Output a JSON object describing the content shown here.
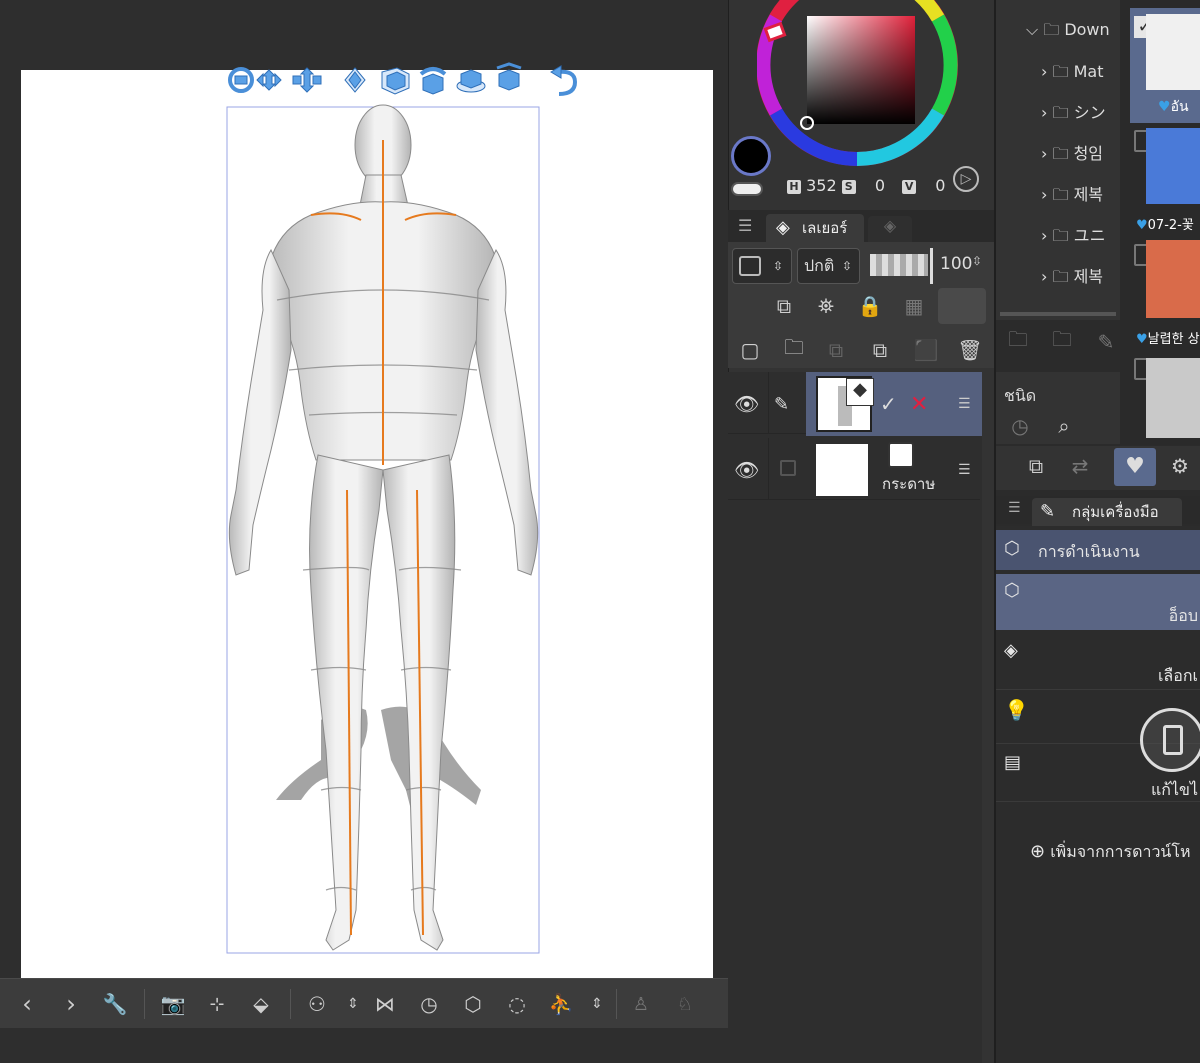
{
  "canvas": {
    "toolbar3d_icons": [
      "rotate-camera-icon",
      "pan-camera-icon",
      "dolly-camera-icon",
      "move-xy-icon",
      "rotate-object-icon",
      "rotate-horizontal-icon",
      "rotate-on-plane-icon",
      "move-on-plane-icon",
      "undo-pose-icon"
    ],
    "bottom_icons": [
      "prev-icon",
      "next-icon",
      "wrench-icon",
      "camera-icon",
      "fit-icon",
      "ground-icon",
      "add-model-icon",
      "stepper-icon",
      "flip-icon",
      "clock-icon",
      "cube-icon",
      "rotate-dotted-icon",
      "pose-icon",
      "stepper2-icon",
      "mannequin-icon",
      "mannequin2-icon"
    ]
  },
  "color_panel": {
    "h_label": "H",
    "h_value": "352",
    "s_label": "S",
    "s_value": "0",
    "v_label": "V",
    "v_value": "0",
    "main_color": "#000000",
    "accent_red": "#c8102e"
  },
  "layer_panel": {
    "tab_label": "เลเยอร์",
    "blend_mode": "ปกติ",
    "opacity": "100",
    "layers": [
      {
        "name": "",
        "selected": true
      },
      {
        "name": "กระดาษ",
        "selected": false
      }
    ]
  },
  "right_panel": {
    "folders": [
      {
        "label": "Down",
        "expanded": true
      },
      {
        "label": "Mat"
      },
      {
        "label": "シン"
      },
      {
        "label": "청임"
      },
      {
        "label": "제복"
      },
      {
        "label": "ユニ"
      },
      {
        "label": "제복"
      }
    ],
    "thumbs": [
      {
        "label": "อัน"
      },
      {
        "label": "07-2-꽃"
      },
      {
        "label": "날렵한 상"
      }
    ],
    "kind_label": "ชนิด",
    "tool_group_tab": "กลุ่มเครื่องมือ",
    "tools": [
      {
        "label": "การดำเนินงาน"
      },
      {
        "label": "อ็อบ"
      },
      {
        "label": "เลือกเ"
      },
      {
        "label": ""
      },
      {
        "label": "แก้ไขไ"
      }
    ],
    "add_download": "เพิ่มจากการดาวน์โห"
  }
}
